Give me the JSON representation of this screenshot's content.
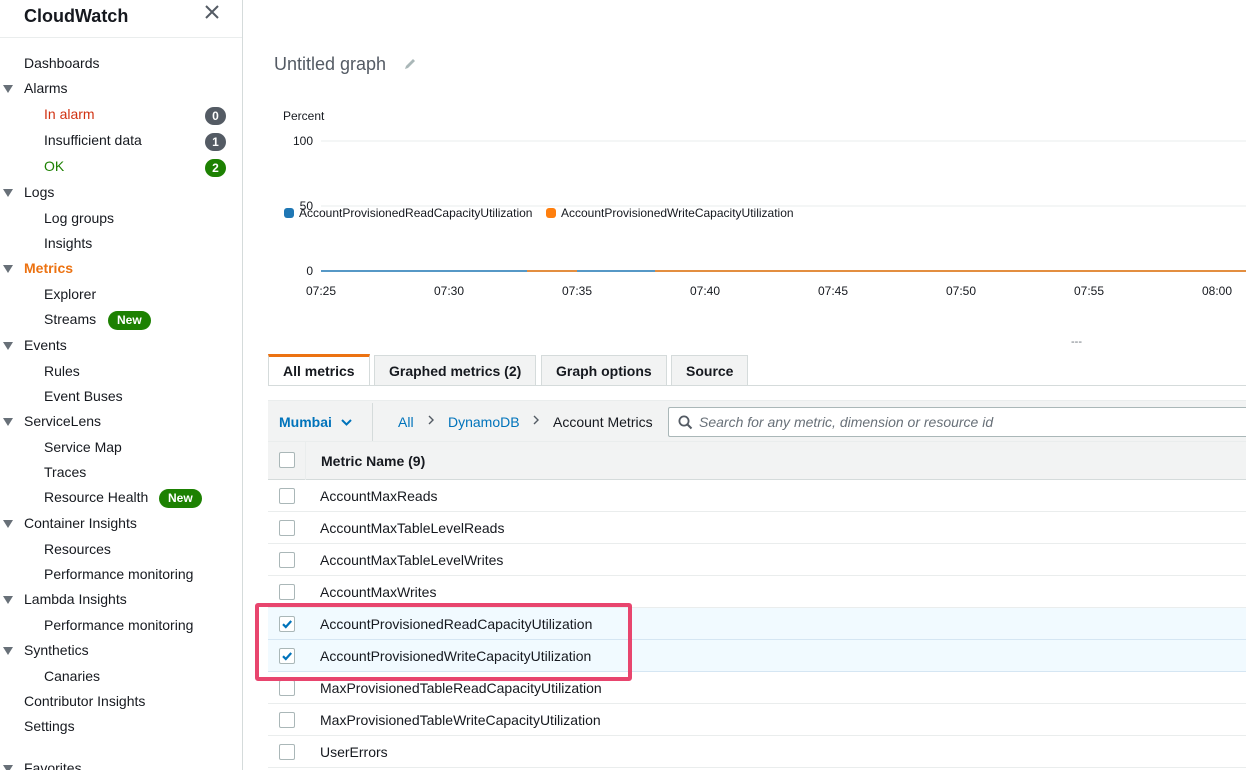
{
  "sidebar": {
    "title": "CloudWatch",
    "items": [
      {
        "label": "Dashboards",
        "level": 0
      },
      {
        "label": "Alarms",
        "level": 0,
        "expandable": true
      },
      {
        "label": "In alarm",
        "level": 1,
        "color": "#d13212",
        "badge": "0",
        "badge_color": "#545b64"
      },
      {
        "label": "Insufficient data",
        "level": 1,
        "badge": "1",
        "badge_color": "#545b64"
      },
      {
        "label": "OK",
        "level": 1,
        "color": "#1d8102",
        "badge": "2",
        "badge_color": "#1d8102"
      },
      {
        "label": "Logs",
        "level": 0,
        "expandable": true
      },
      {
        "label": "Log groups",
        "level": 1
      },
      {
        "label": "Insights",
        "level": 1
      },
      {
        "label": "Metrics",
        "level": 0,
        "expandable": true,
        "active": true,
        "color": "#ec7211"
      },
      {
        "label": "Explorer",
        "level": 1
      },
      {
        "label": "Streams",
        "level": 1,
        "tag": "New"
      },
      {
        "label": "Events",
        "level": 0,
        "expandable": true
      },
      {
        "label": "Rules",
        "level": 1
      },
      {
        "label": "Event Buses",
        "level": 1
      },
      {
        "label": "ServiceLens",
        "level": 0,
        "expandable": true
      },
      {
        "label": "Service Map",
        "level": 1
      },
      {
        "label": "Traces",
        "level": 1
      },
      {
        "label": "Resource Health",
        "level": 1,
        "tag": "New"
      },
      {
        "label": "Container Insights",
        "level": 0,
        "expandable": true
      },
      {
        "label": "Resources",
        "level": 1
      },
      {
        "label": "Performance monitoring",
        "level": 1
      },
      {
        "label": "Lambda Insights",
        "level": 0,
        "expandable": true
      },
      {
        "label": "Performance monitoring",
        "level": 1
      },
      {
        "label": "Synthetics",
        "level": 0,
        "expandable": true
      },
      {
        "label": "Canaries",
        "level": 1
      },
      {
        "label": "Contributor Insights",
        "level": 0
      },
      {
        "label": "Settings",
        "level": 0
      },
      {
        "label": "Favorites",
        "level": 0,
        "expandable": true
      }
    ]
  },
  "graph": {
    "title": "Untitled graph",
    "legend_dashes": "---"
  },
  "chart_data": {
    "type": "line",
    "title": "Untitled graph",
    "ylabel": "Percent",
    "ylim": [
      0,
      100
    ],
    "yticks": [
      "100",
      "50",
      "0"
    ],
    "x": [
      "07:25",
      "07:30",
      "07:35",
      "07:40",
      "07:45",
      "07:50",
      "07:55",
      "08:00"
    ],
    "grid": true,
    "legend_position": "bottom-left",
    "series": [
      {
        "name": "AccountProvisionedReadCapacityUtilization",
        "color": "#1f77b4",
        "values": [
          0,
          0,
          0,
          0,
          0,
          0,
          0,
          0
        ]
      },
      {
        "name": "AccountProvisionedWriteCapacityUtilization",
        "color": "#ff7f0e",
        "values": [
          null,
          null,
          0,
          0,
          0,
          0,
          0,
          0
        ]
      }
    ]
  },
  "tabs": [
    {
      "label": "All metrics",
      "active": true
    },
    {
      "label": "Graphed metrics (2)"
    },
    {
      "label": "Graph options"
    },
    {
      "label": "Source"
    }
  ],
  "filter": {
    "region": "Mumbai",
    "breadcrumbs": [
      {
        "label": "All",
        "link": true
      },
      {
        "label": "DynamoDB",
        "link": true
      },
      {
        "label": "Account Metrics",
        "link": false
      }
    ],
    "search_placeholder": "Search for any metric, dimension or resource id"
  },
  "table": {
    "header": "Metric Name (9)",
    "rows": [
      {
        "name": "AccountMaxReads",
        "checked": false
      },
      {
        "name": "AccountMaxTableLevelReads",
        "checked": false
      },
      {
        "name": "AccountMaxTableLevelWrites",
        "checked": false
      },
      {
        "name": "AccountMaxWrites",
        "checked": false
      },
      {
        "name": "AccountProvisionedReadCapacityUtilization",
        "checked": true
      },
      {
        "name": "AccountProvisionedWriteCapacityUtilization",
        "checked": true
      },
      {
        "name": "MaxProvisionedTableReadCapacityUtilization",
        "checked": false
      },
      {
        "name": "MaxProvisionedTableWriteCapacityUtilization",
        "checked": false
      },
      {
        "name": "UserErrors",
        "checked": false
      }
    ]
  }
}
